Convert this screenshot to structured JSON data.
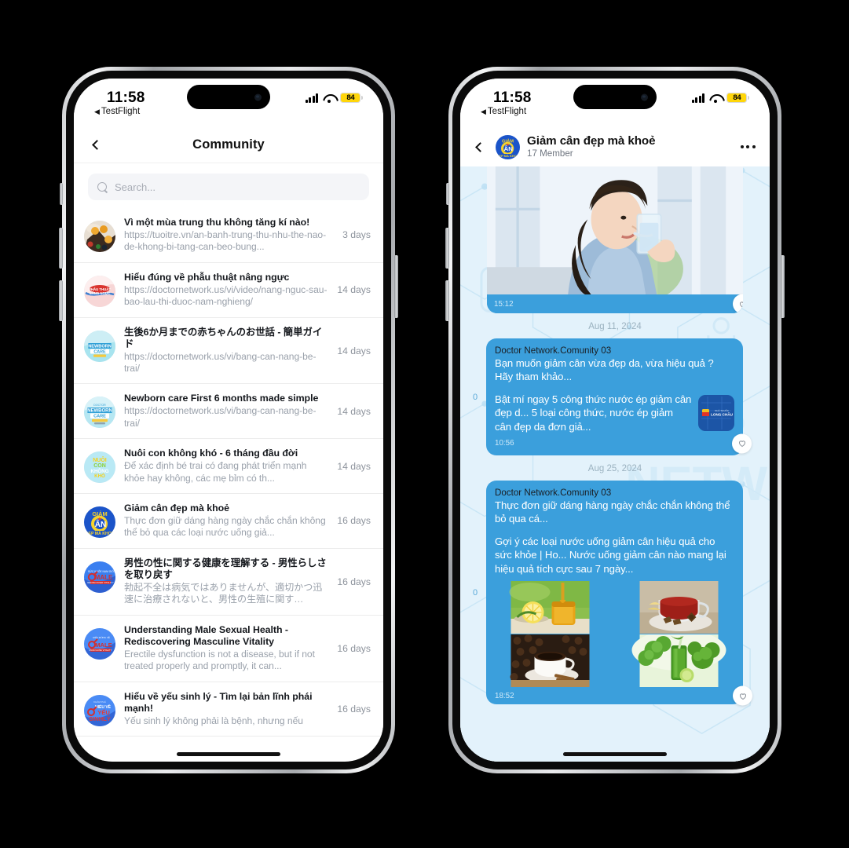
{
  "colors": {
    "accent_blue": "#3b9fdc",
    "chat_bg": "#e3f2fb",
    "battery_yellow": "#FFD60A",
    "muted_text": "#9aa1ab"
  },
  "status_bar": {
    "time": "11:58",
    "back_app": "TestFlight",
    "back_triangle": "◀",
    "battery_level": "84",
    "signal_icon": "cellular-bars-icon",
    "wifi_icon": "wifi-icon",
    "battery_icon": "battery-icon"
  },
  "left_phone": {
    "nav": {
      "back_icon": "chevron-left-icon",
      "title": "Community"
    },
    "search": {
      "placeholder": "Search...",
      "value": "",
      "icon": "search-icon"
    },
    "items": [
      {
        "title": "Vì một mùa trung thu không tăng kí nào!",
        "subtitle": "https://tuoitre.vn/an-banh-trung-thu-nhu-the-nao-de-khong-bi-tang-can-beo-bung...",
        "time": "3 days",
        "avatar": "mooncake-food-avatar"
      },
      {
        "title": "Hiểu đúng về phẫu thuật nâng ngực",
        "subtitle": "https://doctornetwork.us/vi/video/nang-nguc-sau-bao-lau-thi-duoc-nam-nghieng/",
        "time": "14 days",
        "avatar": "nang-nguc-avatar"
      },
      {
        "title": "生後6か月までの赤ちゃんのお世話 - 簡単ガイド",
        "subtitle": "https://doctornetwork.us/vi/bang-can-nang-be-trai/",
        "time": "14 days",
        "avatar": "newborn-care-avatar"
      },
      {
        "title": "Newborn care First 6 months made simple",
        "subtitle": "https://doctornetwork.us/vi/bang-can-nang-be-trai/",
        "time": "14 days",
        "avatar": "newborn-care-avatar-2"
      },
      {
        "title": "Nuôi con không khó - 6 tháng đầu đời",
        "subtitle": "Để xác định bé trai có đang phát triển mạnh khỏe hay không, các mẹ bỉm có th...",
        "time": "14 days",
        "avatar": "nuoi-con-khong-kho-avatar"
      },
      {
        "title": "Giảm cân đẹp mà khoẻ",
        "subtitle": "Thực đơn giữ dáng hàng ngày chắc chắn không thể bỏ qua các loại nước uống giả...",
        "time": "16 days",
        "avatar": "giam-can-avatar"
      },
      {
        "title": "男性の性に関する健康を理解する - 男性らしさを取り戻す",
        "subtitle": "勃起不全は病気ではありませんが、適切かつ迅速に治療されないと、男性の生殖に関す…",
        "time": "16 days",
        "avatar": "male-health-avatar"
      },
      {
        "title": "Understanding Male Sexual Health - Rediscovering Masculine Vitality",
        "subtitle": "Erectile dysfunction is not a disease, but if not treated properly and promptly, it can...",
        "time": "16 days",
        "avatar": "male-health-avatar-2"
      },
      {
        "title": "Hiểu về yếu sinh lý - Tìm lại bản lĩnh phái mạnh!",
        "subtitle": "Yếu sinh lý không phải là bệnh, nhưng nếu",
        "time": "16 days",
        "avatar": "yeu-sinh-ly-avatar"
      }
    ]
  },
  "right_phone": {
    "nav": {
      "back_icon": "chevron-left-icon",
      "avatar": "giam-can-group-avatar",
      "title": "Giảm cân đẹp mà khoẻ",
      "subtitle": "17 Member",
      "more_icon": "more-horizontal-icon"
    },
    "messages": [
      {
        "type": "image",
        "image": "woman-drinking-water-photo",
        "time": "15:12",
        "like_icon": "heart-outline-icon"
      },
      {
        "type": "date",
        "label": "Aug 11, 2024"
      },
      {
        "type": "text",
        "reactions": "0",
        "sender": "Doctor Network.Comunity 03",
        "text": "Bạn muốn giảm cân vừa đẹp da, vừa hiệu quả ? Hãy tham khảo...",
        "link_text": "Bật mí ngay 5 công thức nước ép giảm cân đẹp d... 5 loại công thức, nước ép giảm cân đẹp da đơn giả...",
        "link_thumb": "long-chau-thumbnail",
        "time": "10:56",
        "like_icon": "heart-outline-icon"
      },
      {
        "type": "date",
        "label": "Aug 25, 2024"
      },
      {
        "type": "text_gallery",
        "reactions": "0",
        "sender": "Doctor Network.Comunity 03",
        "text": "Thực đơn giữ dáng hàng ngày chắc chắn không thể bỏ qua cá...",
        "link_text": "Gợi ý các loại nước uống giảm cân hiệu quả cho sức khỏe | Ho... Nước uống giảm cân nào mang lại hiệu quả tích cực sau 7 ngày...",
        "gallery": [
          "lemon-honey-photo",
          "red-tea-photo",
          "coffee-cinnamon-photo",
          "green-smoothie-photo"
        ],
        "time": "18:52",
        "like_icon": "heart-outline-icon"
      }
    ]
  }
}
